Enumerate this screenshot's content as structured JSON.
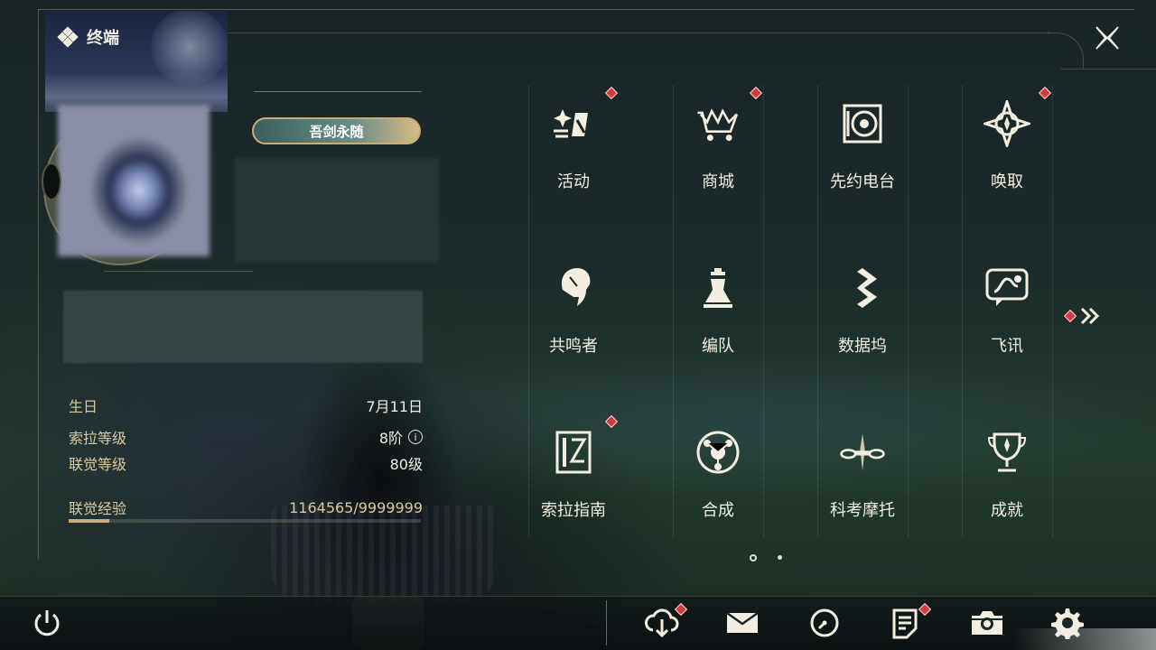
{
  "header": {
    "title": "终端"
  },
  "profile": {
    "title_badge": "吾剑永随",
    "stats": [
      {
        "label": "生日",
        "value": "7月11日"
      },
      {
        "label": "索拉等级",
        "value": "8阶"
      },
      {
        "label": "联觉等级",
        "value": "80级"
      },
      {
        "label": "联觉经验",
        "value": "1164565/9999999"
      }
    ],
    "exp_progress": 0.116
  },
  "grid": [
    {
      "label": "活动",
      "icon": "activity-icon",
      "badge": true
    },
    {
      "label": "商城",
      "icon": "shop-icon",
      "badge": true
    },
    {
      "label": "先约电台",
      "icon": "radio-icon",
      "badge": false
    },
    {
      "label": "唤取",
      "icon": "summon-icon",
      "badge": true
    },
    {
      "label": "共鸣者",
      "icon": "resonator-icon",
      "badge": false
    },
    {
      "label": "编队",
      "icon": "team-icon",
      "badge": false
    },
    {
      "label": "数据坞",
      "icon": "data-bank-icon",
      "badge": false
    },
    {
      "label": "飞讯",
      "icon": "message-icon",
      "badge": false
    },
    {
      "label": "索拉指南",
      "icon": "guide-icon",
      "badge": true
    },
    {
      "label": "合成",
      "icon": "synthesis-icon",
      "badge": false
    },
    {
      "label": "科考摩托",
      "icon": "motorcycle-icon",
      "badge": false
    },
    {
      "label": "成就",
      "icon": "trophy-icon",
      "badge": false
    }
  ],
  "colors": {
    "accent": "#c7ae78",
    "badge": "#d23a44",
    "text": "#f3eee2"
  }
}
